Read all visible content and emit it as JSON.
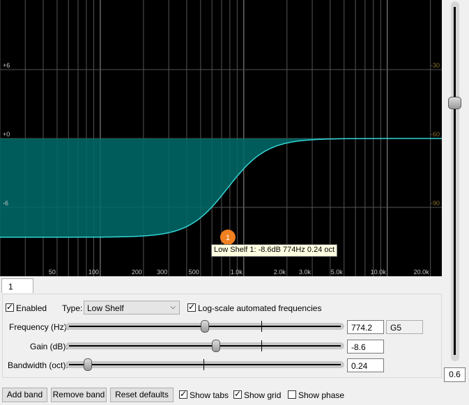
{
  "graph": {
    "db_labels": [
      "+6",
      "+0",
      "-6"
    ],
    "right_labels": [
      "-30",
      "-60",
      "-90"
    ],
    "freq_labels": [
      "50",
      "100",
      "200",
      "300",
      "500",
      "1.0k",
      "2.0k",
      "3.0k",
      "5.0k",
      "10.0k",
      "20.0k"
    ],
    "curve_color": "#33d6d6",
    "fill_color": "#006b6b",
    "grid_color": "#555555",
    "right_label_color": "#8a7030",
    "handle": {
      "label": "1",
      "color": "#f08020"
    }
  },
  "tooltip": {
    "text": "Low Shelf 1: -8.6dB 774Hz 0.24 oct"
  },
  "tabs": [
    {
      "label": "1"
    }
  ],
  "band": {
    "enabled_label": "Enabled",
    "enabled": true,
    "type_label": "Type:",
    "type_value": "Low Shelf",
    "log_scale_label": "Log-scale automated frequencies",
    "log_scale": true,
    "frequency": {
      "label": "Frequency (Hz):",
      "value": "774.2",
      "note": "G5",
      "level": 0.5
    },
    "gain": {
      "label": "Gain (dB):",
      "value": "-8.6",
      "level": 0.54
    },
    "bandwidth": {
      "label": "Bandwidth (oct):",
      "value": "0.24",
      "level": 0.07
    }
  },
  "footer": {
    "add_band": "Add band",
    "remove_band": "Remove band",
    "reset_defaults": "Reset defaults",
    "show_tabs": "Show tabs",
    "show_tabs_checked": true,
    "show_grid": "Show grid",
    "show_grid_checked": true,
    "show_phase": "Show phase",
    "show_phase_checked": false
  },
  "output_gain": {
    "value": "0.6",
    "level": 0.75
  }
}
